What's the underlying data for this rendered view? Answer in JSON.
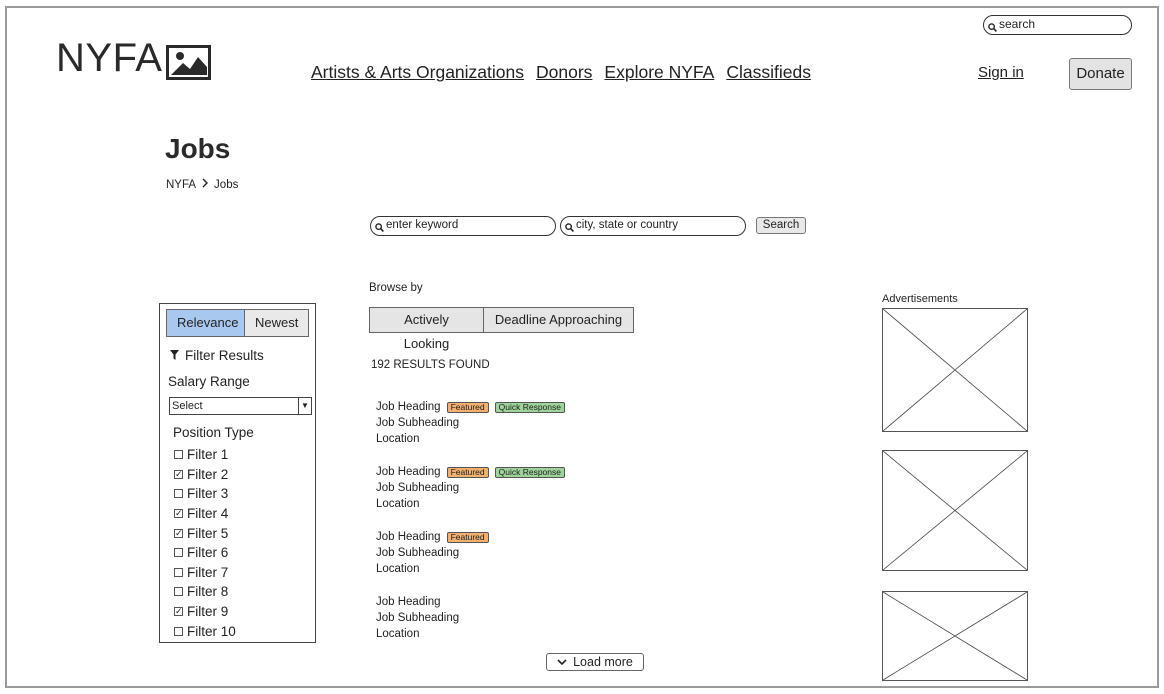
{
  "header": {
    "logo_text": "NYFA",
    "search_placeholder": "search",
    "nav": [
      "Artists & Arts Organizations",
      "Donors",
      "Explore NYFA",
      "Classifieds"
    ],
    "signin": "Sign in",
    "donate": "Donate"
  },
  "page": {
    "title": "Jobs",
    "breadcrumb": [
      "NYFA",
      "Jobs"
    ]
  },
  "search": {
    "keyword_placeholder": "enter keyword",
    "location_placeholder": "city, state or country",
    "button": "Search"
  },
  "filters": {
    "sort": [
      "Relevance",
      "Newest"
    ],
    "sort_selected": "Relevance",
    "filter_results": "Filter Results",
    "salary_label": "Salary Range",
    "salary_value": "Select",
    "position_label": "Position Type",
    "items": [
      {
        "label": "Filter 1",
        "checked": false
      },
      {
        "label": "Filter 2",
        "checked": true
      },
      {
        "label": "Filter 3",
        "checked": false
      },
      {
        "label": "Filter 4",
        "checked": true
      },
      {
        "label": "Filter 5",
        "checked": true
      },
      {
        "label": "Filter 6",
        "checked": false
      },
      {
        "label": "Filter 7",
        "checked": false
      },
      {
        "label": "Filter 8",
        "checked": false
      },
      {
        "label": "Filter 9",
        "checked": true
      },
      {
        "label": "Filter 10",
        "checked": false
      }
    ]
  },
  "browse": {
    "label": "Browse by",
    "buttons": [
      "Actively Looking",
      "Deadline Approaching"
    ]
  },
  "results": {
    "count_text": "192 RESULTS FOUND",
    "jobs": [
      {
        "heading": "Job Heading",
        "subheading": "Job Subheading",
        "location": "Location",
        "featured": "Featured",
        "quick": "Quick Response"
      },
      {
        "heading": "Job Heading",
        "subheading": "Job Subheading",
        "location": "Location",
        "featured": "Featured",
        "quick": "Quick Response"
      },
      {
        "heading": "Job Heading",
        "subheading": "Job Subheading",
        "location": "Location",
        "featured": "Featured",
        "quick": null
      },
      {
        "heading": "Job Heading",
        "subheading": "Job Subheading",
        "location": "Location",
        "featured": null,
        "quick": null
      }
    ],
    "load_more": "Load more"
  },
  "ads": {
    "label": "Advertisements"
  },
  "colors": {
    "selected_tab": "#a9c8f0",
    "featured_badge": "#f3b06e",
    "quick_badge": "#9ed39a"
  }
}
